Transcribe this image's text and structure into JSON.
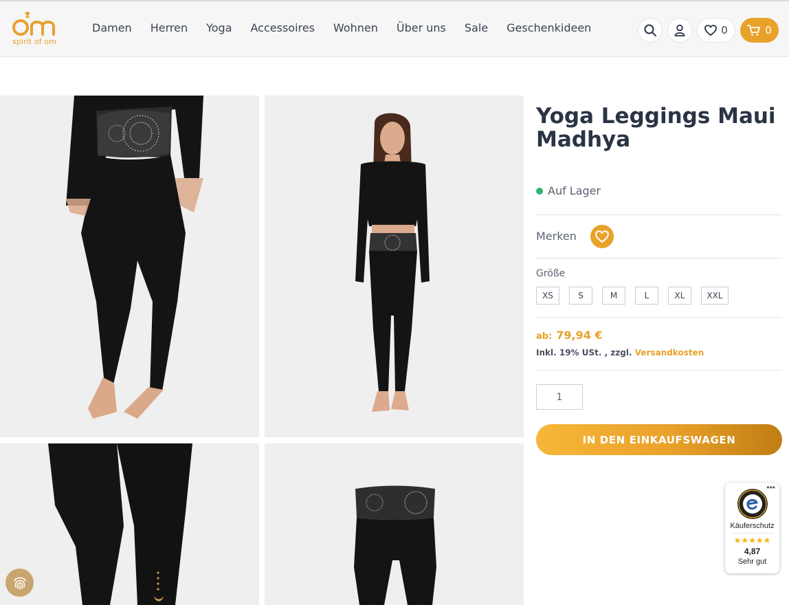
{
  "header": {
    "logo_text": "spirit of om",
    "nav": [
      "Damen",
      "Herren",
      "Yoga",
      "Accessoires",
      "Wohnen",
      "Über uns",
      "Sale",
      "Geschenkideen"
    ],
    "wishlist_count": "0",
    "cart_count": "0"
  },
  "product": {
    "title": "Yoga Leggings Maui Madhya",
    "stock": "Auf Lager",
    "merken_label": "Merken",
    "size_label": "Größe",
    "sizes": [
      "XS",
      "S",
      "M",
      "L",
      "XL",
      "XXL"
    ],
    "price_prefix": "ab:",
    "price": "79,94 €",
    "tax_text": "Inkl. 19% USt. , zzgl.",
    "shipping_link": "Versandkosten",
    "quantity": "1",
    "add_to_cart": "IN DEN EINKAUFSWAGEN"
  },
  "trusted_shops": {
    "dots": "•••",
    "label": "Käuferschutz",
    "stars": "★★★★★",
    "score": "4,87",
    "verdict": "Sehr gut"
  },
  "colors": {
    "accent": "#e8a22a",
    "text": "#2b3445",
    "stock": "#2bb673"
  },
  "icons": {
    "search": "search-icon",
    "account": "user-icon",
    "wishlist": "heart-icon",
    "cart": "cart-icon",
    "fingerprint": "fingerprint-icon"
  }
}
